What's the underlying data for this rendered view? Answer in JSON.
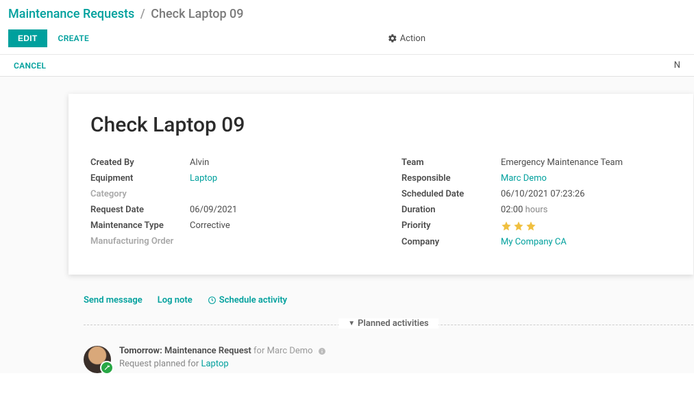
{
  "breadcrumb": {
    "root": "Maintenance Requests",
    "sep": "/",
    "current": "Check Laptop 09"
  },
  "buttons": {
    "edit": "EDIT",
    "create": "CREATE",
    "cancel": "CANCEL",
    "action": "Action"
  },
  "statusbar_right": "N",
  "title": "Check Laptop 09",
  "left": {
    "created_by_label": "Created By",
    "created_by": "Alvin",
    "equipment_label": "Equipment",
    "equipment": "Laptop",
    "category_label": "Category",
    "category": "",
    "request_date_label": "Request Date",
    "request_date": "06/09/2021",
    "maintenance_type_label": "Maintenance Type",
    "maintenance_type": "Corrective",
    "manufacturing_order_label": "Manufacturing Order",
    "manufacturing_order": ""
  },
  "right": {
    "team_label": "Team",
    "team": "Emergency Maintenance Team",
    "responsible_label": "Responsible",
    "responsible": "Marc Demo",
    "scheduled_date_label": "Scheduled Date",
    "scheduled_date": "06/10/2021 07:23:26",
    "duration_label": "Duration",
    "duration_value": "02:00",
    "duration_unit": " hours",
    "priority_label": "Priority",
    "priority": 3,
    "company_label": "Company",
    "company": "My Company CA"
  },
  "chatter": {
    "send_message": "Send message",
    "log_note": "Log note",
    "schedule_activity": "Schedule activity",
    "planned_activities": "Planned activities"
  },
  "activity": {
    "when": "Tomorrow:",
    "type": "Maintenance Request",
    "for_label": "for",
    "user": "Marc Demo",
    "summary_prefix": "Request planned for ",
    "summary_link": "Laptop"
  }
}
